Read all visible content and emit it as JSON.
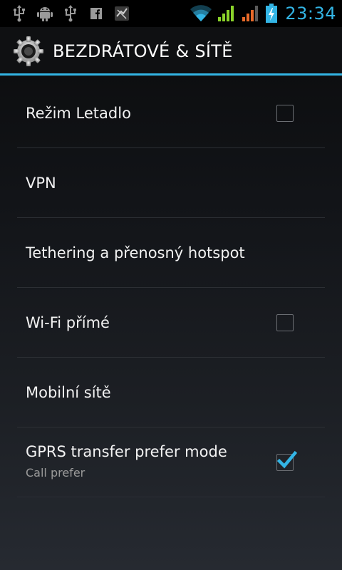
{
  "status_bar": {
    "icons": [
      "usb-icon",
      "android-debug-icon",
      "usb-icon",
      "facebook-icon",
      "app-notification-icon",
      "wifi-icon",
      "signal-icon",
      "signal-roaming-icon",
      "battery-charging-icon"
    ],
    "time": "23:34"
  },
  "header": {
    "icon": "settings-gear-icon",
    "title": "BEZDRÁTOVÉ & SÍTĚ"
  },
  "colors": {
    "accent": "#33b5e5",
    "signal": "#8ad22a",
    "signal_roaming": "#e86a2a"
  },
  "settings": [
    {
      "label": "Režim Letadlo",
      "checkbox": true,
      "checked": false
    },
    {
      "label": "VPN",
      "checkbox": false
    },
    {
      "label": "Tethering a přenosný hotspot",
      "checkbox": false
    },
    {
      "label": "Wi-Fi přímé",
      "checkbox": true,
      "checked": false
    },
    {
      "label": "Mobilní sítě",
      "checkbox": false
    },
    {
      "label": "GPRS transfer prefer mode",
      "sublabel": "Call prefer",
      "checkbox": true,
      "checked": true
    }
  ]
}
